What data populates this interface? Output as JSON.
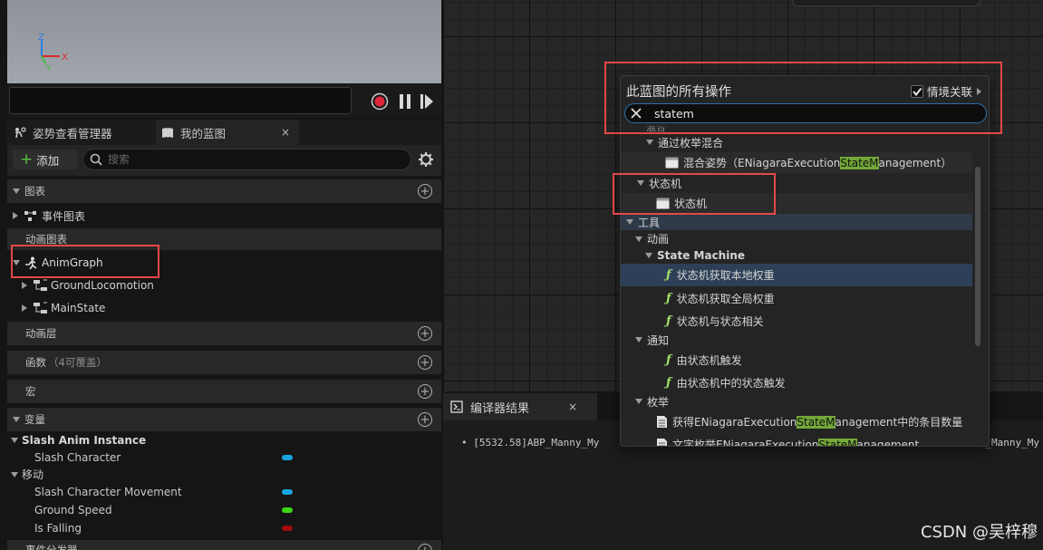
{
  "viewport": {
    "axes": {
      "z": "Z",
      "x": "X",
      "y": "Y"
    }
  },
  "left_tabs": {
    "pose": "姿势查看管理器",
    "blueprint": "我的蓝图",
    "close": "×"
  },
  "toolbar": {
    "add": "添加",
    "search_placeholder": "搜索"
  },
  "sections": {
    "graphs": "图表",
    "event_graph": "事件图表",
    "anim_graphs": "动画图表",
    "anim_graph": "AnimGraph",
    "ground_locomotion": "GroundLocomotion",
    "main_state": "MainState",
    "anim_layers": "动画层",
    "functions": "函数",
    "functions_note": "（4可覆盖）",
    "macros": "宏",
    "variables": "变量",
    "slash_anim_instance": "Slash Anim Instance",
    "slash_character": "Slash Character",
    "movement": "移动",
    "slash_character_movement": "Slash Character Movement",
    "ground_speed": "Ground Speed",
    "is_falling": "Is Falling",
    "event_dispatchers": "事件分发器"
  },
  "variable_colors": {
    "object": "#1aa5e0",
    "float": "#3bd615",
    "bool": "#a30b0b"
  },
  "compiler": {
    "tab": "编译器结果",
    "close": "×",
    "log_left": "[5532.58]ABP_Manny_My",
    "log_right": "_Manny_My"
  },
  "watermark": "CSDN @吴梓穆",
  "menu": {
    "title": "此蓝图的所有操作",
    "context_toggle": "情境关联",
    "context_checked": true,
    "search_value": "statem",
    "items": {
      "blend_partial": "混合",
      "blend_by_enum": "通过枚举混合",
      "blend_pose_pre": "混合姿势（ENiagaraExecution",
      "blend_pose_hl": "StateM",
      "blend_pose_post": "anagement）",
      "state_machine_cat": "状态机",
      "state_machine": "状态机",
      "tools": "工具",
      "animation": "动画",
      "state_machine_en": "State Machine",
      "get_local_weight": "状态机获取本地权重",
      "get_global_weight": "状态机获取全局权重",
      "state_relevant": "状态机与状态相关",
      "notify": "通知",
      "triggered_by_sm": "由状态机触发",
      "triggered_by_state": "由状态机中的状态触发",
      "enum": "枚举",
      "enum_count_pre": "获得ENiagaraExecution",
      "enum_count_hl": "StateM",
      "enum_count_post": "anagement中的条目数量",
      "enum_literal_pre": "文字枚举ENiagaraExecution",
      "enum_literal_hl": "StateM",
      "enum_literal_post": "anagement"
    }
  }
}
